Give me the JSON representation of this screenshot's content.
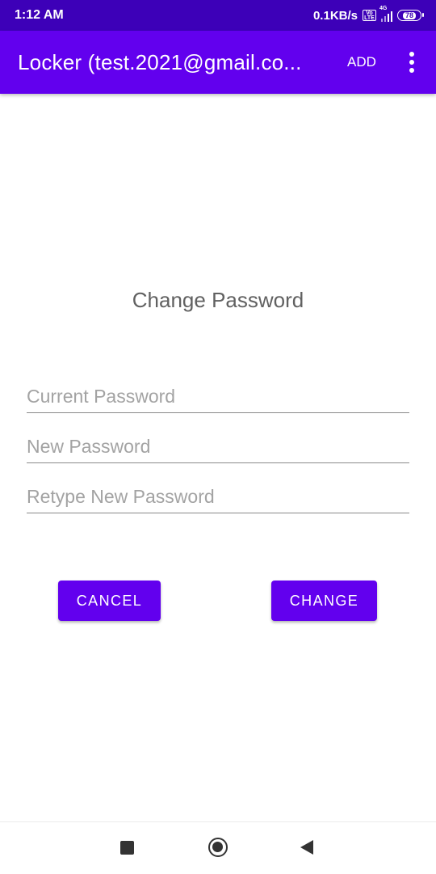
{
  "status_bar": {
    "time": "1:12 AM",
    "network_speed": "0.1KB/s",
    "volte_label": "Vo LTE",
    "network_type": "4G",
    "battery_level": "78"
  },
  "app_bar": {
    "title": "Locker (test.2021@gmail.co...",
    "add_label": "ADD",
    "background_color": "#6200ee"
  },
  "dialog": {
    "title": "Change Password",
    "current_password": {
      "placeholder": "Current Password",
      "value": ""
    },
    "new_password": {
      "placeholder": "New Password",
      "value": ""
    },
    "retype_password": {
      "placeholder": "Retype New Password",
      "value": ""
    },
    "cancel_label": "CANCEL",
    "change_label": "CHANGE"
  },
  "nav_bar": {
    "recents_icon": "square-icon",
    "home_icon": "circle-icon",
    "back_icon": "triangle-back-icon"
  }
}
